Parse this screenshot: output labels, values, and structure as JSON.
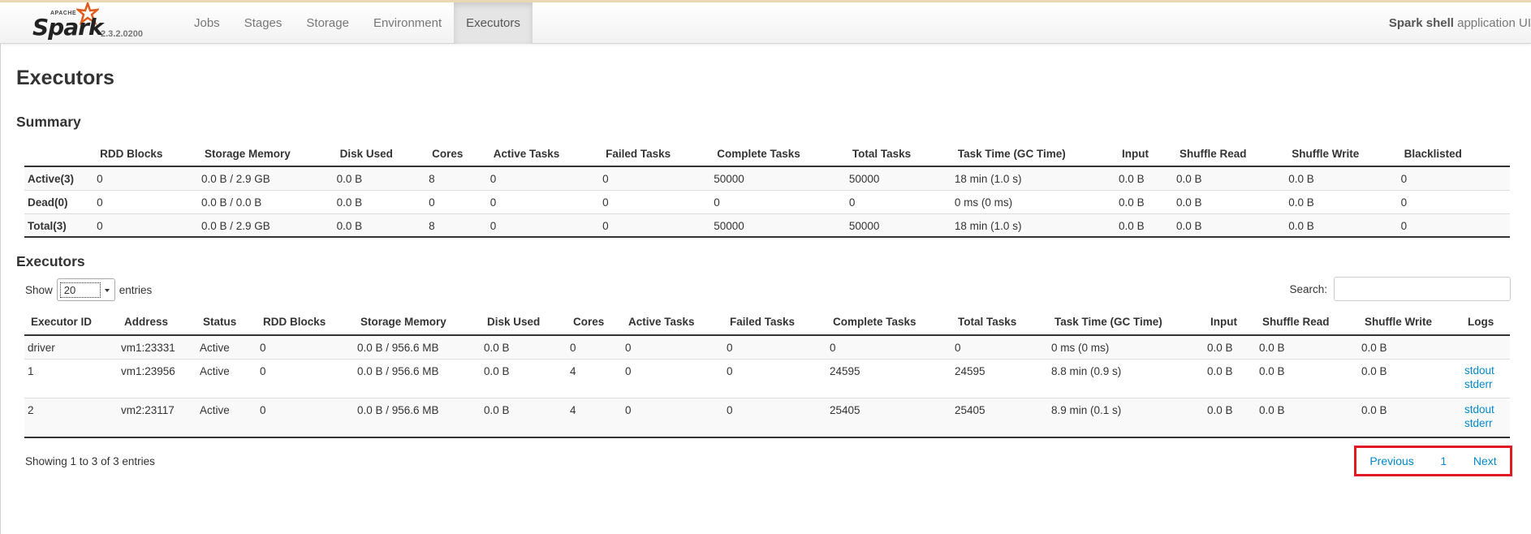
{
  "brand": {
    "apache": "APACHE",
    "name": "Spark",
    "version": "2.3.2.0200"
  },
  "nav": {
    "items": [
      "Jobs",
      "Stages",
      "Storage",
      "Environment",
      "Executors"
    ],
    "active": "Executors"
  },
  "app": {
    "name": "Spark shell",
    "suffix": "application UI"
  },
  "page_title": "Executors",
  "summary": {
    "title": "Summary",
    "columns": [
      "",
      "RDD Blocks",
      "Storage Memory",
      "Disk Used",
      "Cores",
      "Active Tasks",
      "Failed Tasks",
      "Complete Tasks",
      "Total Tasks",
      "Task Time (GC Time)",
      "Input",
      "Shuffle Read",
      "Shuffle Write",
      "Blacklisted"
    ],
    "rows": [
      [
        "Active(3)",
        "0",
        "0.0 B / 2.9 GB",
        "0.0 B",
        "8",
        "0",
        "0",
        "50000",
        "50000",
        "18 min (1.0 s)",
        "0.0 B",
        "0.0 B",
        "0.0 B",
        "0"
      ],
      [
        "Dead(0)",
        "0",
        "0.0 B / 0.0 B",
        "0.0 B",
        "0",
        "0",
        "0",
        "0",
        "0",
        "0 ms (0 ms)",
        "0.0 B",
        "0.0 B",
        "0.0 B",
        "0"
      ],
      [
        "Total(3)",
        "0",
        "0.0 B / 2.9 GB",
        "0.0 B",
        "8",
        "0",
        "0",
        "50000",
        "50000",
        "18 min (1.0 s)",
        "0.0 B",
        "0.0 B",
        "0.0 B",
        "0"
      ]
    ]
  },
  "executors": {
    "title": "Executors",
    "show_label": "Show",
    "page_size": "20",
    "entries_label": "entries",
    "search_label": "Search:",
    "columns": [
      "Executor ID",
      "Address",
      "Status",
      "RDD Blocks",
      "Storage Memory",
      "Disk Used",
      "Cores",
      "Active Tasks",
      "Failed Tasks",
      "Complete Tasks",
      "Total Tasks",
      "Task Time (GC Time)",
      "Input",
      "Shuffle Read",
      "Shuffle Write",
      "Logs"
    ],
    "rows": [
      [
        "driver",
        "vm1:23331",
        "Active",
        "0",
        "0.0 B / 956.6 MB",
        "0.0 B",
        "0",
        "0",
        "0",
        "0",
        "0",
        "0 ms (0 ms)",
        "0.0 B",
        "0.0 B",
        "0.0 B"
      ],
      [
        "1",
        "vm1:23956",
        "Active",
        "0",
        "0.0 B / 956.6 MB",
        "0.0 B",
        "4",
        "0",
        "0",
        "24595",
        "24595",
        "8.8 min (0.9 s)",
        "0.0 B",
        "0.0 B",
        "0.0 B"
      ],
      [
        "2",
        "vm2:23117",
        "Active",
        "0",
        "0.0 B / 956.6 MB",
        "0.0 B",
        "4",
        "0",
        "0",
        "25405",
        "25405",
        "8.9 min (0.1 s)",
        "0.0 B",
        "0.0 B",
        "0.0 B"
      ]
    ],
    "logs": {
      "stdout": "stdout",
      "stderr": "stderr"
    },
    "info": "Showing 1 to 3 of 3 entries",
    "pagination": {
      "previous": "Previous",
      "page": "1",
      "next": "Next"
    }
  }
}
